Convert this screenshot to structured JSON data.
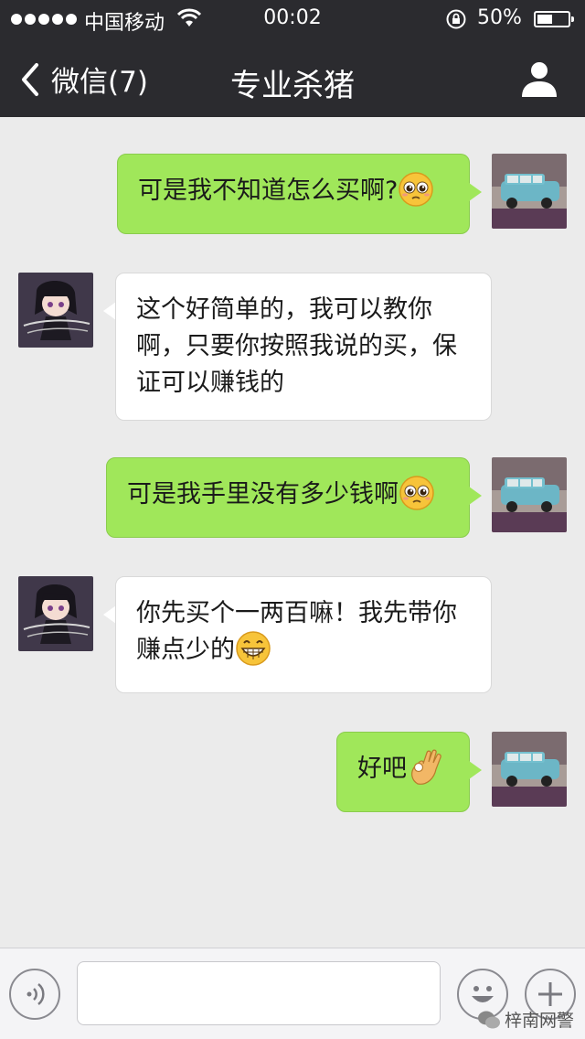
{
  "status_bar": {
    "carrier": "中国移动",
    "time": "00:02",
    "battery": "50%",
    "battery_level": 0.5
  },
  "nav": {
    "back_label": "微信(7)",
    "title": "专业杀猪"
  },
  "messages": [
    {
      "direction": "outgoing",
      "text": "可是我不知道怎么买啊?",
      "emoji": "worried-face-emoji"
    },
    {
      "direction": "incoming",
      "text": "这个好简单的，我可以教你啊，只要你按照我说的买，保证可以赚钱的",
      "lines": [
        "这个好简单的，我可以教你",
        "啊，只要你按照我说的买，保",
        "证可以赚钱的"
      ]
    },
    {
      "direction": "outgoing",
      "text": "可是我手里没有多少钱啊",
      "emoji": "worried-face-emoji"
    },
    {
      "direction": "incoming",
      "text": "你先买个一两百嘛！我先带你赚点少的",
      "lines": [
        "你先买个一两百嘛！我先带你",
        "赚点少的"
      ],
      "emoji": "grinning-face-emoji"
    },
    {
      "direction": "outgoing",
      "text": "好吧",
      "emoji": "ok-hand-emoji"
    }
  ],
  "input": {
    "placeholder": ""
  },
  "watermark": {
    "text": "梓南网警"
  },
  "colors": {
    "header": "#2b2b2f",
    "background": "#ebebeb",
    "outgoing_bubble": "#a0e75a",
    "incoming_bubble": "#ffffff"
  }
}
